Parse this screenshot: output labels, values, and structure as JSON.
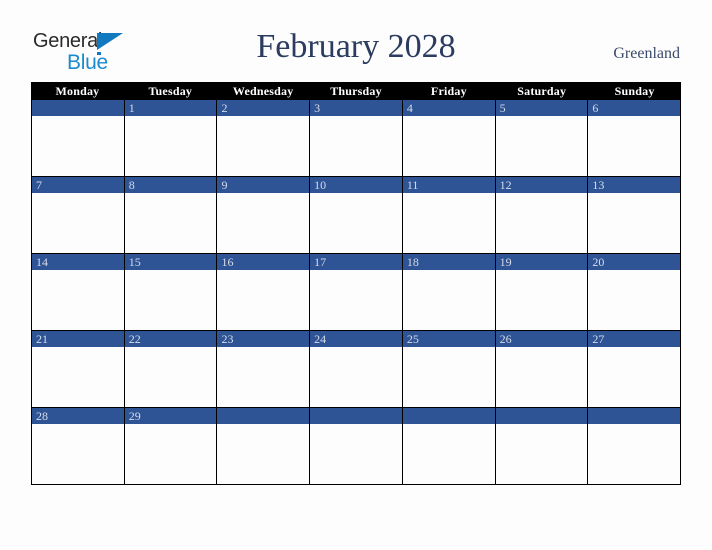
{
  "header": {
    "logo": {
      "word_one": "General",
      "word_two": "Blue",
      "triangle_color": "#1179bf",
      "blue_text_color": "#1b8bce"
    },
    "title": "February 2028",
    "region": "Greenland"
  },
  "calendar": {
    "month": "February",
    "year": "2028",
    "weekday_headers": [
      "Monday",
      "Tuesday",
      "Wednesday",
      "Thursday",
      "Friday",
      "Saturday",
      "Sunday"
    ],
    "accent_color": "#2e5496",
    "header_background": "#000000",
    "weeks": [
      {
        "days": [
          "",
          "1",
          "2",
          "3",
          "4",
          "5",
          "6"
        ]
      },
      {
        "days": [
          "7",
          "8",
          "9",
          "10",
          "11",
          "12",
          "13"
        ]
      },
      {
        "days": [
          "14",
          "15",
          "16",
          "17",
          "18",
          "19",
          "20"
        ]
      },
      {
        "days": [
          "21",
          "22",
          "23",
          "24",
          "25",
          "26",
          "27"
        ]
      },
      {
        "days": [
          "28",
          "29",
          "",
          "",
          "",
          "",
          ""
        ]
      }
    ]
  }
}
